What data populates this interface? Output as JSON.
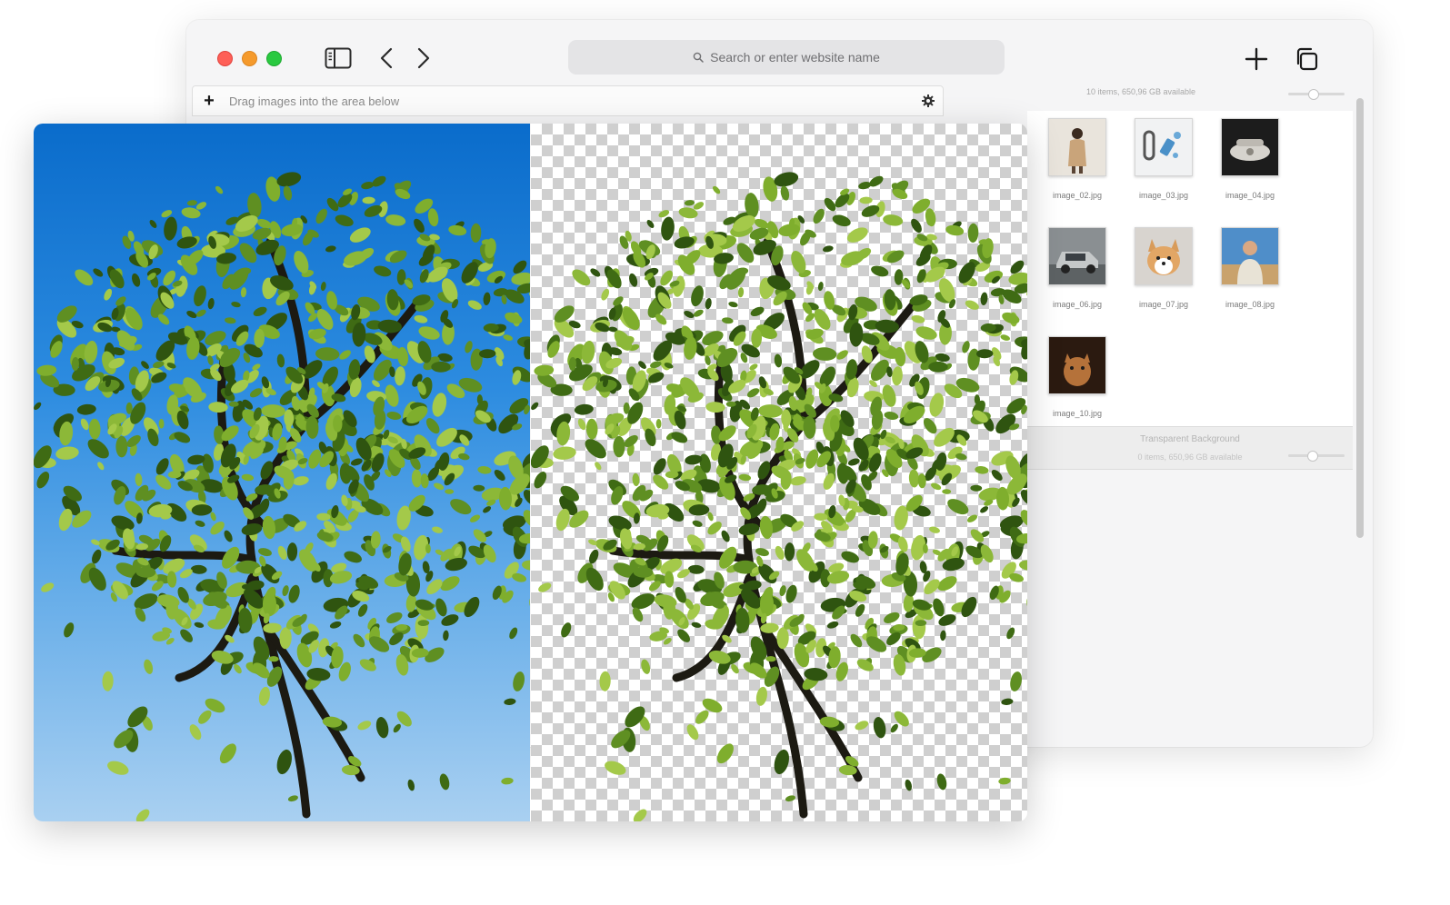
{
  "browser": {
    "search_placeholder": "Search or enter website name"
  },
  "drop_area": {
    "add_symbol": "+",
    "label": "Drag images into the area below"
  },
  "finder": {
    "status": "10 items, 650,96 GB available",
    "files": [
      {
        "name": "image_02.jpg",
        "icon": "woman-photo"
      },
      {
        "name": "image_03.jpg",
        "icon": "dumbbell-bottle-photo"
      },
      {
        "name": "image_04.jpg",
        "icon": "telephone-photo"
      },
      {
        "name": "image_06.jpg",
        "icon": "car-photo"
      },
      {
        "name": "image_07.jpg",
        "icon": "corgi-photo"
      },
      {
        "name": "image_08.jpg",
        "icon": "man-photo"
      },
      {
        "name": "image_10.jpg",
        "icon": "cat-photo"
      }
    ],
    "section": {
      "title": "Transparent Background",
      "status": "0 items, 650,96 GB available"
    }
  },
  "comparison": {
    "before": "tree-on-sky",
    "after": "tree-transparent-background"
  },
  "colors": {
    "close": "#fe5f57",
    "minimize": "#f59a2c",
    "zoom": "#29c940",
    "sky_top": "#0a6ccb",
    "sky_bottom": "#a9d0f1",
    "foliage": "#6f9a2a"
  }
}
